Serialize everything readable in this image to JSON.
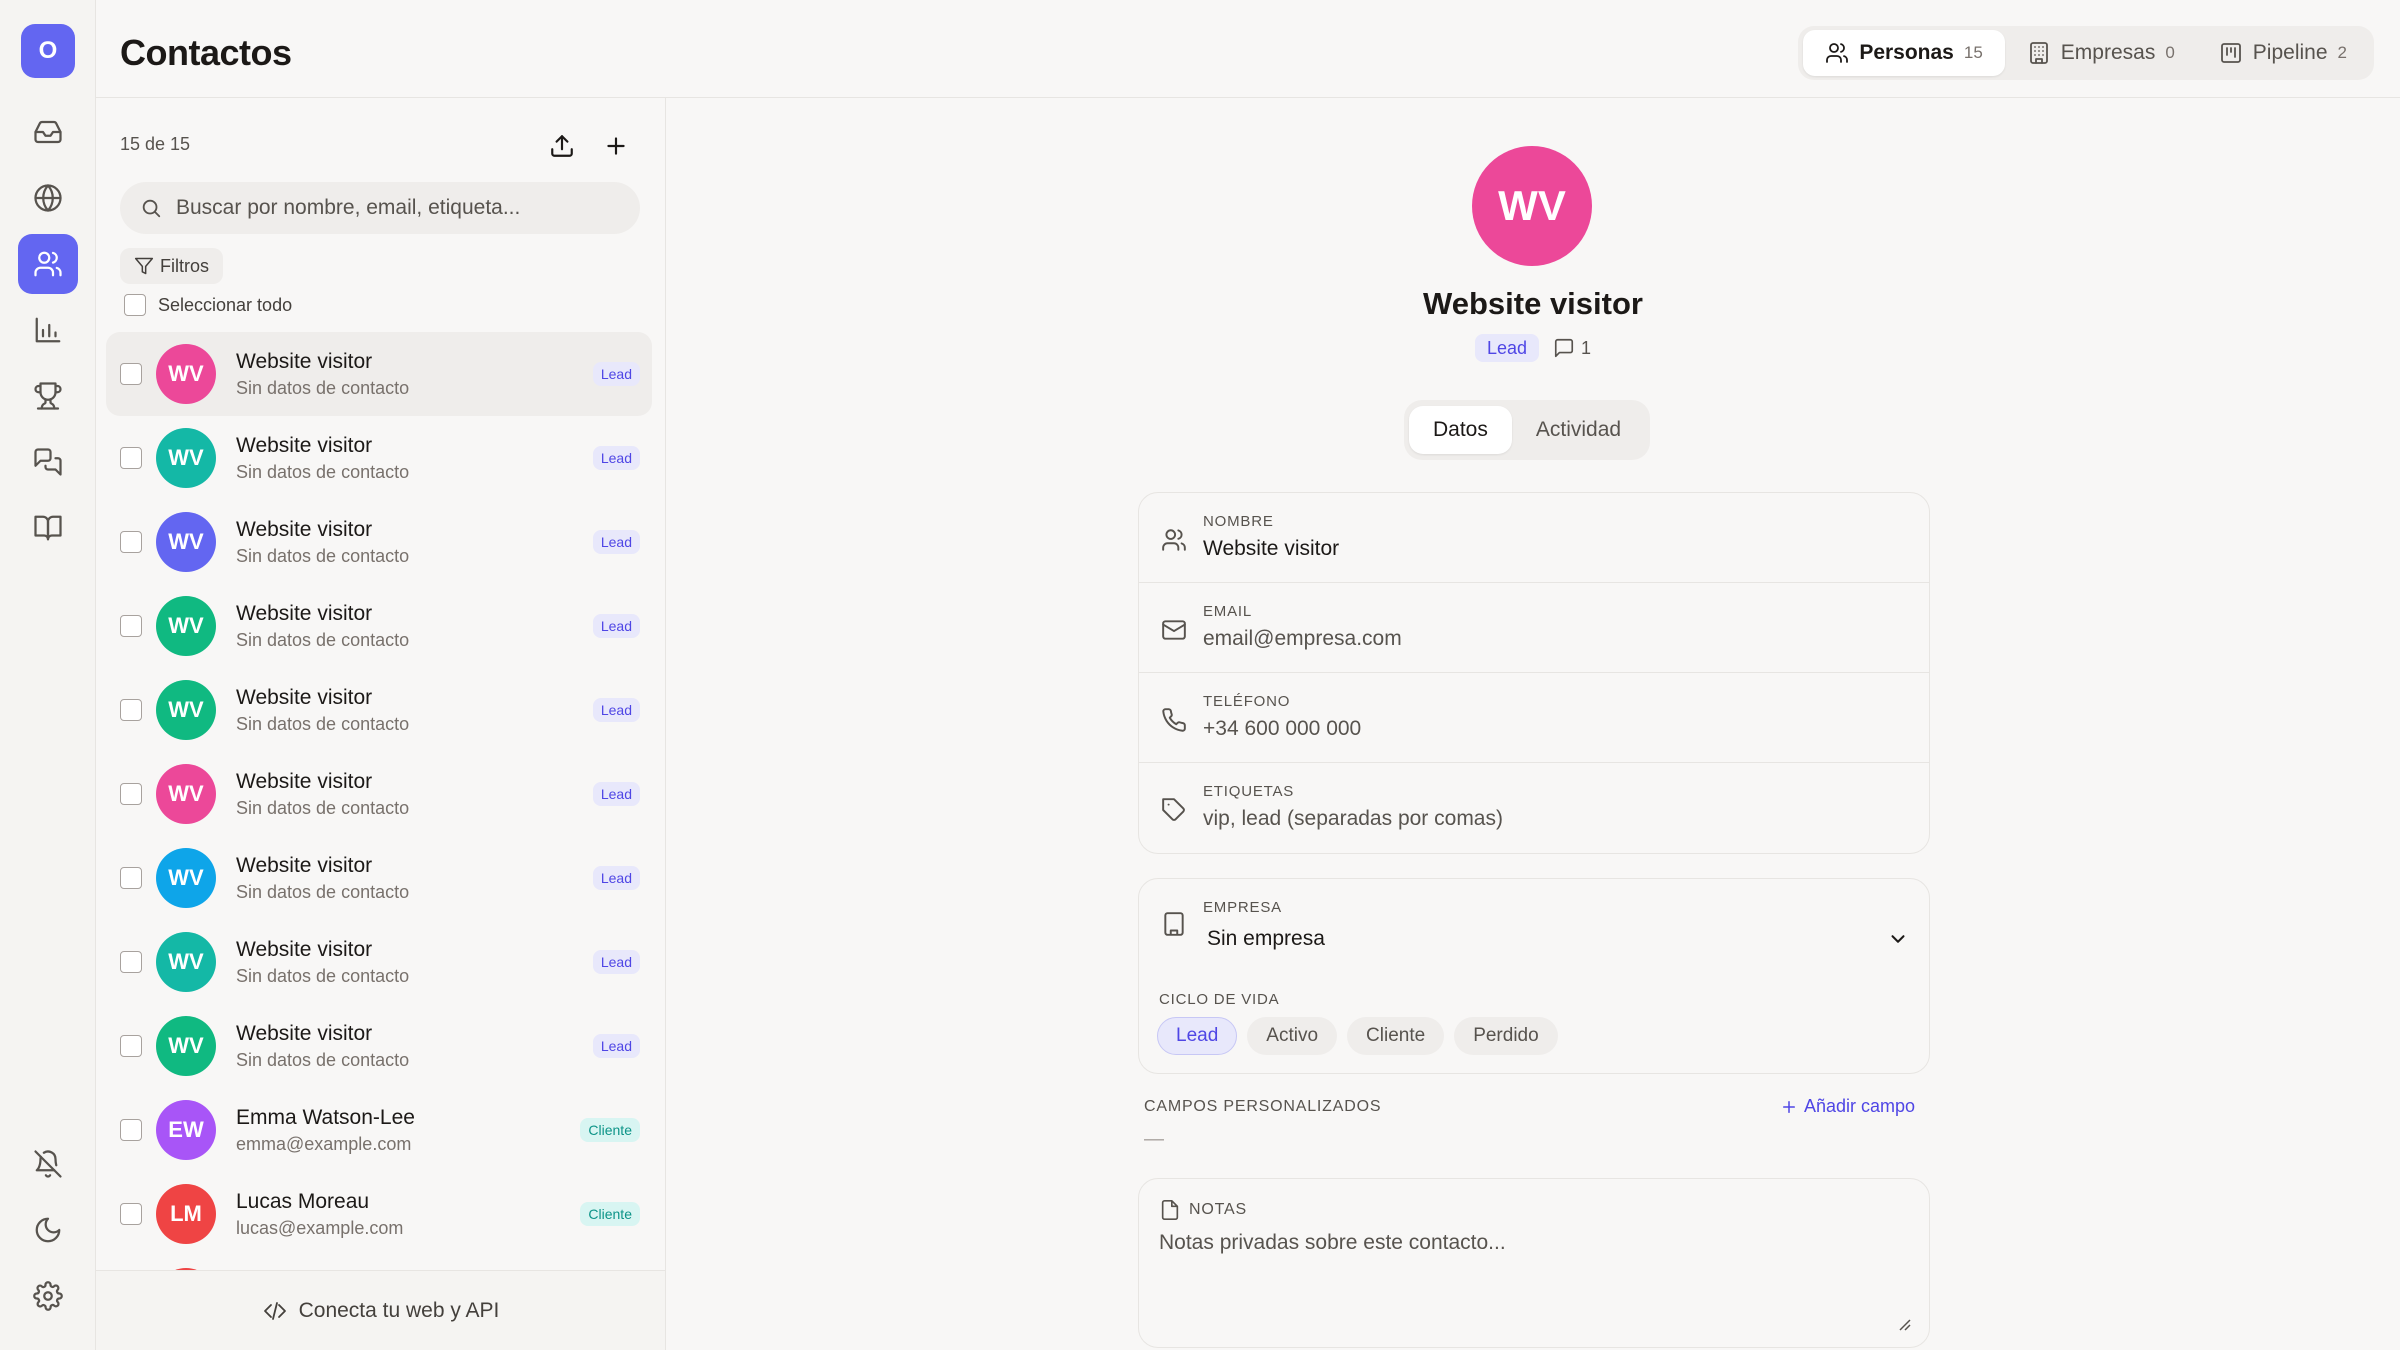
{
  "app": {
    "org_initial": "O",
    "title": "Contactos"
  },
  "rail": {
    "items": [
      {
        "icon": "inbox-icon"
      },
      {
        "icon": "globe-icon"
      },
      {
        "icon": "users-icon",
        "active": true
      },
      {
        "icon": "bar-chart-icon"
      },
      {
        "icon": "trophy-icon"
      },
      {
        "icon": "chat-icon"
      },
      {
        "icon": "book-icon"
      }
    ],
    "bottom": [
      {
        "icon": "bell-off-icon"
      },
      {
        "icon": "moon-icon"
      },
      {
        "icon": "gear-icon"
      }
    ]
  },
  "view_switch": [
    {
      "label": "Personas",
      "count": "15",
      "icon": "users-icon",
      "active": true
    },
    {
      "label": "Empresas",
      "count": "0",
      "icon": "building-icon"
    },
    {
      "label": "Pipeline",
      "count": "2",
      "icon": "kanban-icon"
    }
  ],
  "list": {
    "count_text": "15 de 15",
    "search_placeholder": "Buscar por nombre, email, etiqueta...",
    "filters_label": "Filtros",
    "select_all_label": "Seleccionar todo",
    "contacts": [
      {
        "initials": "WV",
        "name": "Website visitor",
        "sub": "Sin datos de contacto",
        "badge": "Lead",
        "color": "#ec4899",
        "selected": true
      },
      {
        "initials": "WV",
        "name": "Website visitor",
        "sub": "Sin datos de contacto",
        "badge": "Lead",
        "color": "#14b8a6"
      },
      {
        "initials": "WV",
        "name": "Website visitor",
        "sub": "Sin datos de contacto",
        "badge": "Lead",
        "color": "#6366f1"
      },
      {
        "initials": "WV",
        "name": "Website visitor",
        "sub": "Sin datos de contacto",
        "badge": "Lead",
        "color": "#10b981"
      },
      {
        "initials": "WV",
        "name": "Website visitor",
        "sub": "Sin datos de contacto",
        "badge": "Lead",
        "color": "#10b981"
      },
      {
        "initials": "WV",
        "name": "Website visitor",
        "sub": "Sin datos de contacto",
        "badge": "Lead",
        "color": "#ec4899"
      },
      {
        "initials": "WV",
        "name": "Website visitor",
        "sub": "Sin datos de contacto",
        "badge": "Lead",
        "color": "#0ea5e9"
      },
      {
        "initials": "WV",
        "name": "Website visitor",
        "sub": "Sin datos de contacto",
        "badge": "Lead",
        "color": "#14b8a6"
      },
      {
        "initials": "WV",
        "name": "Website visitor",
        "sub": "Sin datos de contacto",
        "badge": "Lead",
        "color": "#10b981"
      },
      {
        "initials": "EW",
        "name": "Emma Watson-Lee",
        "sub": "emma@example.com",
        "badge": "Cliente",
        "color": "#a855f7"
      },
      {
        "initials": "LM",
        "name": "Lucas Moreau",
        "sub": "lucas@example.com",
        "badge": "Cliente",
        "color": "#ef4444"
      },
      {
        "initials": "",
        "name": "",
        "sub": "",
        "badge": "",
        "color": "#ef4444"
      }
    ],
    "footer_label": "Conecta tu web y API"
  },
  "detail": {
    "initials": "WV",
    "avatar_color": "#ec4899",
    "name": "Website visitor",
    "stage": "Lead",
    "message_count": "1",
    "tabs": [
      "Datos",
      "Actividad"
    ],
    "fields": [
      {
        "label": "NOMBRE",
        "value": "Website visitor",
        "placeholder": "",
        "icon": "user-icon"
      },
      {
        "label": "EMAIL",
        "value": "",
        "placeholder": "email@empresa.com",
        "icon": "mail-icon"
      },
      {
        "label": "TELÉFONO",
        "value": "",
        "placeholder": "+34 600 000 000",
        "icon": "phone-icon"
      },
      {
        "label": "ETIQUETAS",
        "value": "",
        "placeholder": "vip, lead (separadas por comas)",
        "icon": "tag-icon"
      }
    ],
    "company": {
      "label": "EMPRESA",
      "value": "Sin empresa"
    },
    "lifecycle": {
      "label": "CICLO DE VIDA",
      "options": [
        "Lead",
        "Activo",
        "Cliente",
        "Perdido"
      ],
      "selected": "Lead"
    },
    "custom_fields": {
      "label": "CAMPOS PERSONALIZADOS",
      "add_label": "Añadir campo",
      "empty": "—"
    },
    "notes": {
      "label": "NOTAS",
      "placeholder": "Notas privadas sobre este contacto..."
    }
  },
  "colors": {
    "accent": "#6366f1",
    "lead_bg": "#e8e8fb",
    "lead_text": "#4f46e5",
    "cliente_bg": "#d8f5f2",
    "cliente_text": "#0d9488"
  }
}
